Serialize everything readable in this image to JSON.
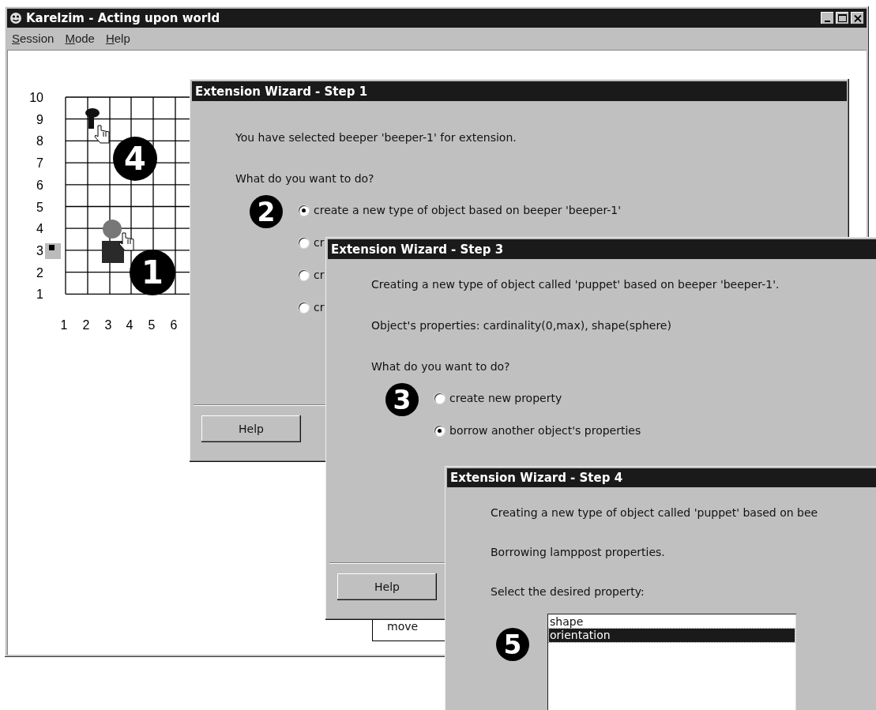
{
  "main_window": {
    "title": "Karelzim - Acting upon world",
    "menu": [
      {
        "label": "Session"
      },
      {
        "label": "Mode"
      },
      {
        "label": "Help"
      }
    ],
    "world": {
      "y_labels": [
        "10",
        "9",
        "8",
        "7",
        "6",
        "5",
        "4",
        "3",
        "2",
        "1"
      ],
      "x_labels": [
        "1",
        "2",
        "3",
        "4",
        "5",
        "6"
      ],
      "badges": [
        "4",
        "1"
      ]
    },
    "command_list": {
      "items": [
        "move"
      ]
    }
  },
  "dialogs": [
    {
      "title": "Extension Wizard - Step 1",
      "content": [
        {
          "kind": "text",
          "text": "You have selected beeper 'beeper-1' for extension."
        },
        {
          "kind": "text",
          "text": "What do you want to do?"
        },
        {
          "kind": "radios",
          "badge": "2",
          "options": [
            {
              "label": "create a new type of object based on beeper 'beeper-1'",
              "selected": true
            },
            {
              "label": "cr",
              "selected": false
            },
            {
              "label": "cr",
              "selected": false
            },
            {
              "label": "cr",
              "selected": false
            }
          ]
        }
      ],
      "help_button": "Help"
    },
    {
      "title": "Extension Wizard - Step 3",
      "content": [
        {
          "kind": "text",
          "text": "Creating a new type of object called 'puppet' based on beeper 'beeper-1'."
        },
        {
          "kind": "text",
          "text": "Object's properties: cardinality(0,max), shape(sphere)"
        },
        {
          "kind": "text",
          "text": "What do you want to do?"
        },
        {
          "kind": "radios",
          "badge": "3",
          "options": [
            {
              "label": "create new property",
              "selected": false
            },
            {
              "label": "borrow another object's properties",
              "selected": true
            }
          ]
        }
      ],
      "help_button": "Help"
    },
    {
      "title": "Extension Wizard - Step 4",
      "content": [
        {
          "kind": "text",
          "text": "Creating a new type of object called 'puppet' based on bee"
        },
        {
          "kind": "text",
          "text": "Borrowing lamppost properties."
        },
        {
          "kind": "text",
          "text": "Select the desired property:"
        },
        {
          "kind": "listbox",
          "badge": "5",
          "items": [
            {
              "label": "shape",
              "selected": false
            },
            {
              "label": "orientation",
              "selected": true
            }
          ]
        }
      ]
    }
  ]
}
